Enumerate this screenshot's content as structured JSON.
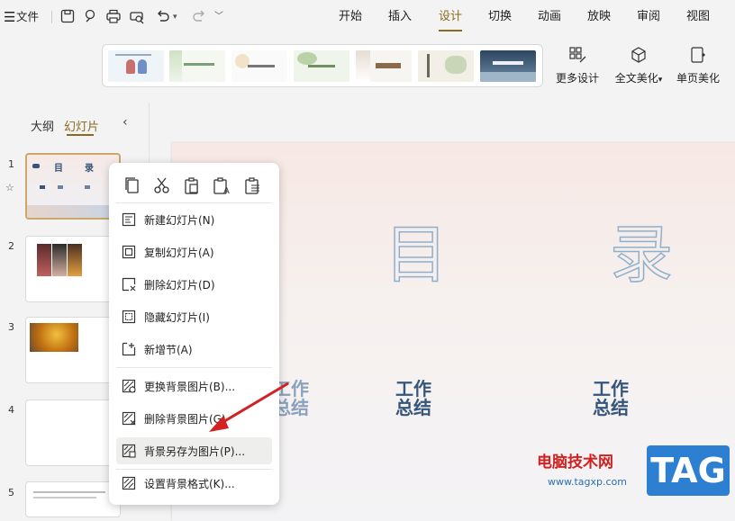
{
  "app": {
    "menu_icon": "hamburger-icon",
    "file_label": "文件"
  },
  "quick_access": [
    "save-icon",
    "pen-icon",
    "print-icon",
    "print-preview-icon",
    "undo-icon",
    "redo-icon",
    "more-icon"
  ],
  "tabs": [
    {
      "label": "开始",
      "active": false
    },
    {
      "label": "插入",
      "active": false
    },
    {
      "label": "设计",
      "active": true
    },
    {
      "label": "切换",
      "active": false
    },
    {
      "label": "动画",
      "active": false
    },
    {
      "label": "放映",
      "active": false
    },
    {
      "label": "审阅",
      "active": false
    },
    {
      "label": "视图",
      "active": false
    }
  ],
  "ribbon": {
    "more_design": "更多设计",
    "full_beautify": "全文美化",
    "page_beautify": "单页美化"
  },
  "panel": {
    "outline_tab": "大纲",
    "slides_tab": "幻灯片",
    "collapse_icon": "chevron-left-icon"
  },
  "slides": [
    {
      "num": "1"
    },
    {
      "num": "2"
    },
    {
      "num": "3"
    },
    {
      "num": "4"
    },
    {
      "num": "5"
    }
  ],
  "slide1_thumb": {
    "c1": "目",
    "c2": "录"
  },
  "main_slide": {
    "title_left": "目",
    "title_right": "录",
    "item1_l1": "工作",
    "item1_l2": "总结",
    "item2_l1": "工作",
    "item2_l2": "总结",
    "item3_l1": "工作",
    "item3_l2": "总结"
  },
  "context_menu": {
    "icons": [
      "copy-icon",
      "cut-icon",
      "paste-icon",
      "paste-text-icon",
      "paste-special-icon"
    ],
    "items": [
      {
        "label": "新建幻灯片(N)"
      },
      {
        "label": "复制幻灯片(A)"
      },
      {
        "label": "删除幻灯片(D)"
      },
      {
        "label": "隐藏幻灯片(I)"
      },
      {
        "label": "新增节(A)"
      },
      {
        "label": "更换背景图片(B)..."
      },
      {
        "label": "删除背景图片(G)"
      },
      {
        "label": "背景另存为图片(P)..."
      },
      {
        "label": "设置背景格式(K)..."
      }
    ]
  },
  "watermark": {
    "site_name": "电脑技术网",
    "url": "www.tagxp.com",
    "tag": "TAG"
  },
  "colors": {
    "accent": "#8a6a1e",
    "arrow": "#d32020",
    "tag_bg": "#2d7fd2"
  }
}
